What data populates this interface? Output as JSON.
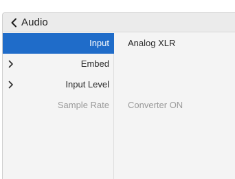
{
  "header": {
    "title": "Audio",
    "back_icon": "chevron-left-icon"
  },
  "menu": {
    "items": [
      {
        "label": "Input",
        "selected": true,
        "has_submenu": false,
        "disabled": false
      },
      {
        "label": "Embed",
        "selected": false,
        "has_submenu": true,
        "disabled": false
      },
      {
        "label": "Input Level",
        "selected": false,
        "has_submenu": true,
        "disabled": false
      },
      {
        "label": "Sample Rate",
        "selected": false,
        "has_submenu": false,
        "disabled": true
      }
    ]
  },
  "values": {
    "input": "Analog XLR",
    "embed": "",
    "input_level": "",
    "sample_rate": "Converter ON"
  },
  "colors": {
    "accent": "#1f6cc9",
    "background": "#f4f4f4",
    "header_background": "#ebebeb",
    "text": "#2a2a2a",
    "muted_text": "#9a9a9a"
  }
}
